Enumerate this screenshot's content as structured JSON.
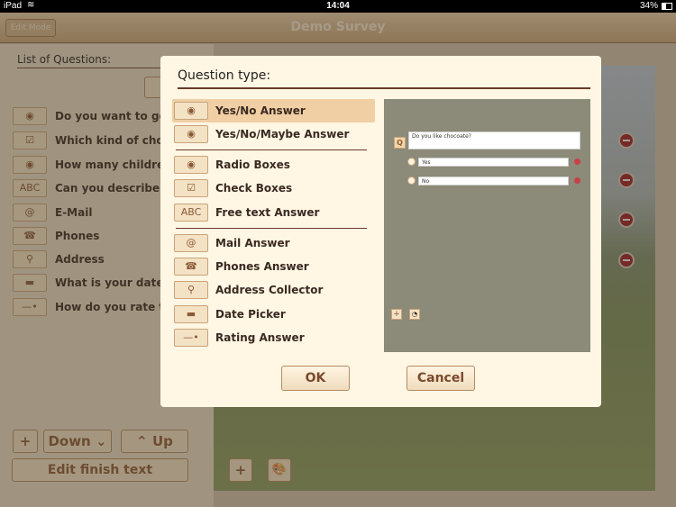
{
  "status": {
    "device": "iPad",
    "time": "14:04",
    "battery": "34%"
  },
  "nav": {
    "back": "Edit Mode",
    "title": "Demo Survey"
  },
  "left": {
    "heading": "List of Questions:",
    "questions": [
      {
        "icon": "radio-icon",
        "glyph": "◉",
        "label": "Do you want to go..."
      },
      {
        "icon": "checkbox-icon",
        "glyph": "☑",
        "label": "Which kind of choco..."
      },
      {
        "icon": "radio-icon",
        "glyph": "◉",
        "label": "How many children..."
      },
      {
        "icon": "abc-icon",
        "glyph": "ABC",
        "label": "Can you describe yo..."
      },
      {
        "icon": "at-icon",
        "glyph": "@",
        "label": "E-Mail"
      },
      {
        "icon": "phone-icon",
        "glyph": "☎",
        "label": "Phones"
      },
      {
        "icon": "pin-icon",
        "glyph": "⚲",
        "label": "Address"
      },
      {
        "icon": "calendar-icon",
        "glyph": "▬",
        "label": "What is your date of..."
      },
      {
        "icon": "slider-icon",
        "glyph": "—•",
        "label": "How do you rate the..."
      }
    ],
    "add": "+",
    "down": "Down",
    "up": "Up",
    "edit_finish": "Edit finish text"
  },
  "right": {
    "add": "+",
    "palette_icon": "palette-icon"
  },
  "dialog": {
    "title": "Question type:",
    "groups": [
      [
        {
          "icon": "radio-icon",
          "glyph": "◉",
          "label": "Yes/No Answer",
          "selected": true
        },
        {
          "icon": "radio-icon",
          "glyph": "◉",
          "label": "Yes/No/Maybe Answer"
        }
      ],
      [
        {
          "icon": "radio-icon",
          "glyph": "◉",
          "label": "Radio Boxes"
        },
        {
          "icon": "checkbox-icon",
          "glyph": "☑",
          "label": "Check Boxes"
        },
        {
          "icon": "abc-icon",
          "glyph": "ABC",
          "label": "Free text Answer"
        }
      ],
      [
        {
          "icon": "at-icon",
          "glyph": "@",
          "label": "Mail Answer"
        },
        {
          "icon": "phone-icon",
          "glyph": "☎",
          "label": "Phones Answer"
        },
        {
          "icon": "pin-icon",
          "glyph": "⚲",
          "label": "Address Collector"
        },
        {
          "icon": "calendar-icon",
          "glyph": "▬",
          "label": "Date Picker"
        },
        {
          "icon": "slider-icon",
          "glyph": "—•",
          "label": "Rating Answer"
        }
      ]
    ],
    "preview": {
      "q_badge": "Q",
      "question": "Do you like chocoate?",
      "answers": [
        "Yes",
        "No"
      ]
    },
    "ok": "OK",
    "cancel": "Cancel"
  }
}
